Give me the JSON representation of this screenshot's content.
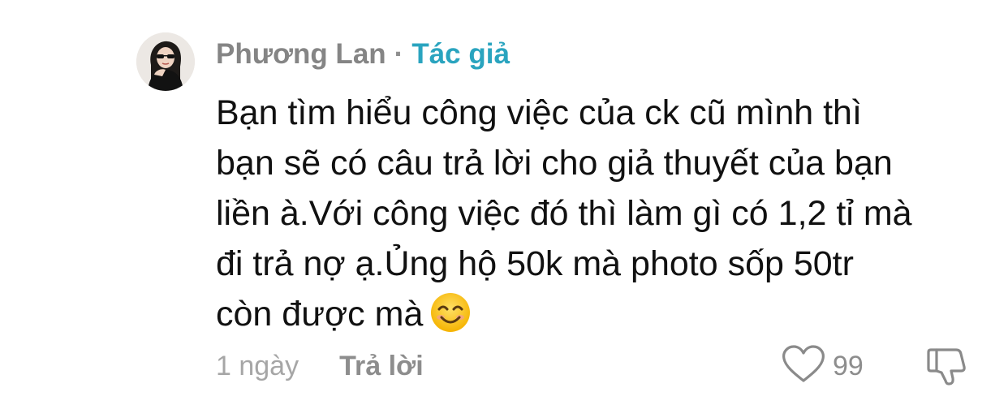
{
  "comment": {
    "author": {
      "name": "Phương Lan",
      "separator": "·",
      "tag": "Tác giả",
      "tag_color": "#2aa4bf"
    },
    "body_lines": [
      "Bạn tìm hiểu công việc của ck cũ mình thì",
      "bạn sẽ có câu trả lời cho giả thuyết của bạn",
      "liền à.Với công việc đó thì làm gì có 1,2 tỉ mà",
      "đi trả nợ ạ.Ủng hộ 50k mà photo sốp 50tr",
      "còn được mà"
    ],
    "emoji": "smiling-face-emoji",
    "time": "1 ngày",
    "reply_label": "Trả lời",
    "like_count": "99",
    "icons": {
      "like": "heart-icon",
      "dislike": "thumbs-down-icon"
    }
  }
}
